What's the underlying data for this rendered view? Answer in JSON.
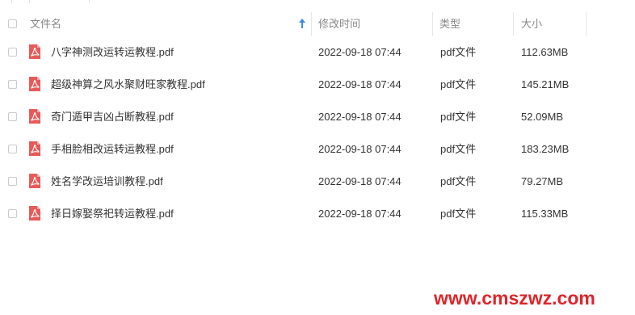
{
  "colors": {
    "pdf_icon": "#e85a5a",
    "sort_arrow": "#3b8bea",
    "watermark": "#e0242a"
  },
  "header": {
    "columns": {
      "name": "文件名",
      "modified": "修改时间",
      "type": "类型",
      "size": "大小"
    },
    "sort_icon": "arrow-up-icon"
  },
  "files": [
    {
      "name": "八字神测改运转运教程.pdf",
      "modified": "2022-09-18 07:44",
      "type": "pdf文件",
      "size": "112.63MB",
      "icon": "pdf-file-icon"
    },
    {
      "name": "超级神算之风水聚财旺家教程.pdf",
      "modified": "2022-09-18 07:44",
      "type": "pdf文件",
      "size": "145.21MB",
      "icon": "pdf-file-icon"
    },
    {
      "name": "奇门遁甲吉凶占断教程.pdf",
      "modified": "2022-09-18 07:44",
      "type": "pdf文件",
      "size": "52.09MB",
      "icon": "pdf-file-icon"
    },
    {
      "name": "手相脸相改运转运教程.pdf",
      "modified": "2022-09-18 07:44",
      "type": "pdf文件",
      "size": "183.23MB",
      "icon": "pdf-file-icon"
    },
    {
      "name": "姓名学改运培训教程.pdf",
      "modified": "2022-09-18 07:44",
      "type": "pdf文件",
      "size": "79.27MB",
      "icon": "pdf-file-icon"
    },
    {
      "name": "择日嫁娶祭祀转运教程.pdf",
      "modified": "2022-09-18 07:44",
      "type": "pdf文件",
      "size": "115.33MB",
      "icon": "pdf-file-icon"
    }
  ],
  "watermark": "www.cmszwz.com"
}
